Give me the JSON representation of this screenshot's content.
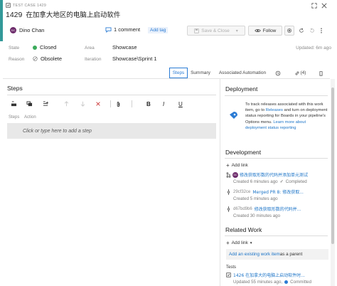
{
  "header": {
    "work_item_type": "TEST CASE 1429",
    "id": "1429",
    "title": "在加拿大地区的电脑上启动软件",
    "assignee_initials": "DC",
    "assignee": "Dino Chan",
    "comments": "1 comment",
    "add_tag": "Add tag",
    "save_close": "Save & Close",
    "follow": "Follow",
    "accent_color": "#339999"
  },
  "fields": {
    "state_label": "State",
    "state_value": "Closed",
    "state_color": "#3bab5b",
    "reason_label": "Reason",
    "reason_value": "Obsolete",
    "area_label": "Area",
    "area_value": "Showcase",
    "iteration_label": "Iteration",
    "iteration_value": "Showcase\\Sprint 1",
    "updated": "Updated: 6m ago"
  },
  "tabs": {
    "steps": "Steps",
    "summary": "Summary",
    "associated_automation": "Associated Automation",
    "links_count": "(4)"
  },
  "steps_panel": {
    "title": "Steps",
    "col_steps": "Steps",
    "col_action": "Action",
    "placeholder": "Click or type here to add a step"
  },
  "deployment": {
    "title": "Deployment",
    "text_1": "To track releases associated with this work item, go to ",
    "link_1": "Releases",
    "text_2": " and turn on deployment status reporting for Boards in your pipeline's Options menu. ",
    "link_2": "Learn more about deployment status reporting"
  },
  "development": {
    "title": "Development",
    "add_link": "Add link",
    "items": [
      {
        "icon": "branch-icon",
        "avatar": "DC",
        "title": "修改获取形数的代码并添加单元测试",
        "meta": "Created 6 minutes ago",
        "status": "Completed"
      },
      {
        "icon": "commit-icon",
        "id": "29cf32ce",
        "title": "Merged PR 8: 修改获取...",
        "meta": "Created 5 minutes ago",
        "status": ""
      },
      {
        "icon": "commit-icon",
        "id": "d67bd9b6",
        "title": "修改获取形数的代码并...",
        "meta": "Created 30 minutes ago",
        "status": ""
      }
    ]
  },
  "related_work": {
    "title": "Related Work",
    "add_link": "Add link",
    "existing_link": "Add an existing work item",
    "existing_suffix": " as a parent",
    "tests_label": "Tests",
    "test_item": "1426 在加拿大的电脑上启动软件时...",
    "test_meta": "Updated 55 minutes ago,",
    "test_status": "Committed"
  }
}
